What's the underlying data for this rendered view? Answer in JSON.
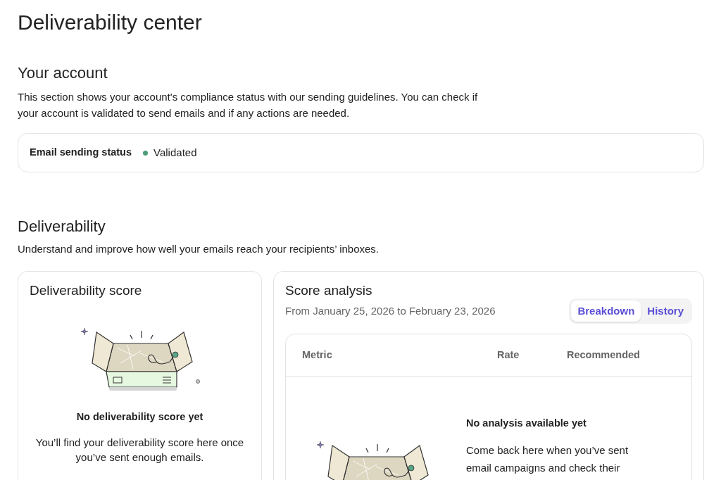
{
  "page": {
    "title": "Deliverability center"
  },
  "account": {
    "heading": "Your account",
    "description": "This section shows your account's compliance status with our sending guidelines. You can check if your account is validated to send emails and if any actions are needed.",
    "status_label": "Email sending status",
    "status_text": "Validated"
  },
  "deliverability": {
    "heading": "Deliverability",
    "description": "Understand and improve how well your emails reach your recipients’ inboxes.",
    "score_card": {
      "title": "Deliverability score",
      "empty_title": "No deliverability score yet",
      "empty_text": "You’ll find your deliverability score here once you’ve sent enough emails."
    },
    "analysis": {
      "title": "Score analysis",
      "date_range": "From January 25, 2026 to February 23, 2026",
      "tabs": [
        {
          "label": "Breakdown",
          "selected": true
        },
        {
          "label": "History",
          "selected": false
        }
      ],
      "columns": [
        "Metric",
        "Rate",
        "Recommended"
      ],
      "empty_title": "No analysis available yet",
      "empty_text": "Come back here when you’ve sent email campaigns and check their"
    }
  }
}
